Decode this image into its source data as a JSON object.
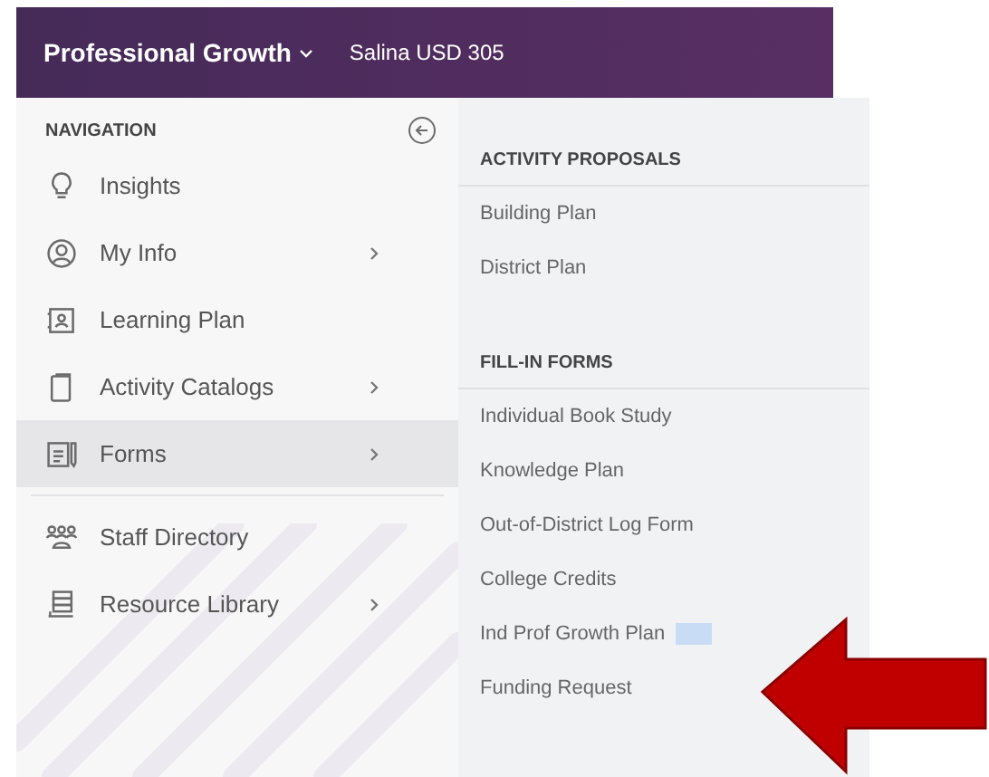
{
  "header": {
    "title": "Professional Growth",
    "district": "Salina USD 305"
  },
  "navigation": {
    "heading": "NAVIGATION",
    "items": [
      {
        "label": "Insights",
        "chevron": false,
        "selected": false
      },
      {
        "label": "My Info",
        "chevron": true,
        "selected": false
      },
      {
        "label": "Learning Plan",
        "chevron": false,
        "selected": false
      },
      {
        "label": "Activity Catalogs",
        "chevron": true,
        "selected": false
      },
      {
        "label": "Forms",
        "chevron": true,
        "selected": true
      }
    ],
    "secondary_items": [
      {
        "label": "Staff Directory",
        "chevron": false,
        "selected": false
      },
      {
        "label": "Resource Library",
        "chevron": true,
        "selected": false
      }
    ]
  },
  "submenu": {
    "sections": [
      {
        "heading": "ACTIVITY PROPOSALS",
        "items": [
          {
            "label": "Building Plan",
            "highlighted": false
          },
          {
            "label": "District Plan",
            "highlighted": false
          }
        ]
      },
      {
        "heading": "FILL-IN FORMS",
        "items": [
          {
            "label": "Individual Book Study",
            "highlighted": false
          },
          {
            "label": "Knowledge Plan",
            "highlighted": false
          },
          {
            "label": "Out-of-District Log Form",
            "highlighted": false
          },
          {
            "label": "College Credits",
            "highlighted": false
          },
          {
            "label": "Ind Prof Growth Plan",
            "highlighted": true
          },
          {
            "label": "Funding Request",
            "highlighted": false
          }
        ]
      }
    ]
  }
}
